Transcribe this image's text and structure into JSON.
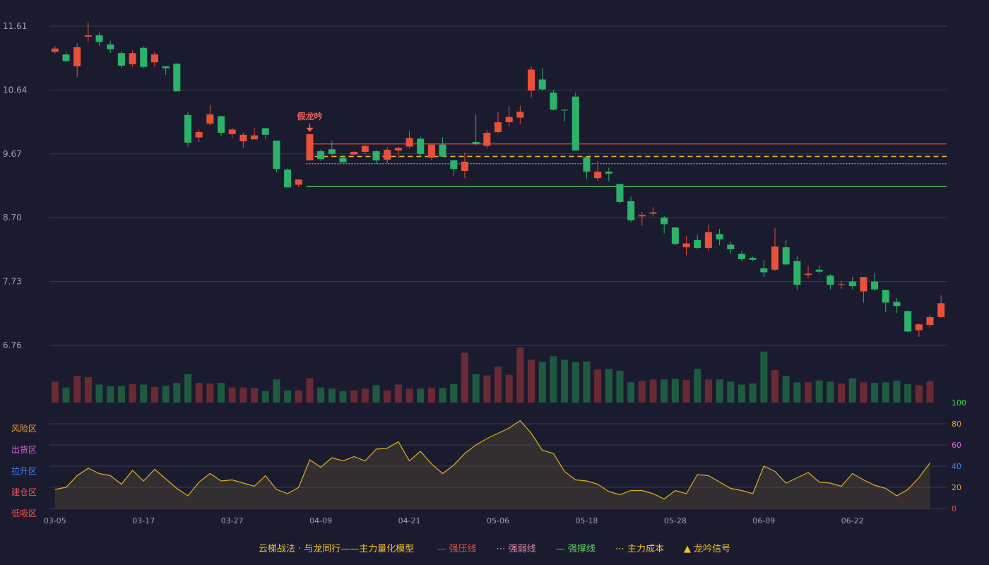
{
  "colors": {
    "background": "#1a1b2e",
    "grid": "#3a3b4e",
    "up": "#e8503a",
    "down": "#2bb36a",
    "resistance": "#e8503a",
    "weak": "#e887a8",
    "support": "#5ad25a",
    "cost": "#f0c030",
    "indicator_line": "#e0b020",
    "axis_text": "#a0a0b0"
  },
  "chart_data": {
    "type": "candlestick",
    "price_axis": {
      "ticks": [
        "11.61",
        "10.64",
        "9.67",
        "8.70",
        "7.73",
        "6.76"
      ],
      "range": [
        6.76,
        11.61
      ]
    },
    "x_tick_labels": [
      {
        "index": 0,
        "label": "03-05"
      },
      {
        "index": 8,
        "label": "03-17"
      },
      {
        "index": 16,
        "label": "03-27"
      },
      {
        "index": 24,
        "label": "04-09"
      },
      {
        "index": 32,
        "label": "04-21"
      },
      {
        "index": 40,
        "label": "05-06"
      },
      {
        "index": 48,
        "label": "05-18"
      },
      {
        "index": 56,
        "label": "05-28"
      },
      {
        "index": 64,
        "label": "06-09"
      },
      {
        "index": 72,
        "label": "06-22"
      }
    ],
    "candles": [
      [
        11.22,
        11.27,
        11.31,
        11.19
      ],
      [
        11.18,
        11.08,
        11.23,
        11.06
      ],
      [
        11.0,
        11.29,
        11.35,
        10.84
      ],
      [
        11.45,
        11.47,
        11.67,
        11.37
      ],
      [
        11.47,
        11.37,
        11.51,
        11.31
      ],
      [
        11.33,
        11.26,
        11.39,
        11.2
      ],
      [
        11.2,
        11.01,
        11.23,
        10.97
      ],
      [
        11.03,
        11.2,
        11.24,
        10.99
      ],
      [
        11.28,
        10.99,
        11.3,
        10.97
      ],
      [
        11.06,
        11.18,
        11.22,
        10.99
      ],
      [
        11.0,
        10.97,
        11.0,
        10.87
      ],
      [
        11.04,
        10.62,
        11.04,
        10.62
      ],
      [
        10.26,
        9.84,
        10.3,
        9.78
      ],
      [
        9.92,
        10.0,
        10.04,
        9.85
      ],
      [
        10.13,
        10.27,
        10.41,
        10.1
      ],
      [
        10.24,
        9.99,
        10.25,
        9.94
      ],
      [
        9.97,
        10.04,
        10.06,
        9.91
      ],
      [
        9.86,
        9.96,
        9.99,
        9.76
      ],
      [
        9.89,
        9.95,
        10.06,
        9.89
      ],
      [
        10.06,
        9.96,
        10.06,
        9.9
      ],
      [
        9.87,
        9.44,
        9.87,
        9.39
      ],
      [
        9.43,
        9.16,
        9.45,
        9.16
      ],
      [
        9.2,
        9.28,
        9.28,
        9.16
      ],
      [
        9.57,
        9.97,
        9.97,
        9.57
      ],
      [
        9.71,
        9.59,
        9.74,
        9.56
      ],
      [
        9.74,
        9.67,
        9.87,
        9.64
      ],
      [
        9.61,
        9.54,
        9.65,
        9.54
      ],
      [
        9.66,
        9.7,
        9.71,
        9.65
      ],
      [
        9.7,
        9.79,
        9.81,
        9.66
      ],
      [
        9.71,
        9.57,
        9.73,
        9.52
      ],
      [
        9.58,
        9.73,
        9.77,
        9.53
      ],
      [
        9.72,
        9.76,
        9.78,
        9.61
      ],
      [
        9.78,
        9.91,
        10.02,
        9.75
      ],
      [
        9.9,
        9.67,
        9.93,
        9.63
      ],
      [
        9.61,
        9.81,
        9.81,
        9.57
      ],
      [
        9.81,
        9.63,
        9.92,
        9.63
      ],
      [
        9.57,
        9.44,
        9.58,
        9.34
      ],
      [
        9.41,
        9.55,
        9.69,
        9.3
      ],
      [
        9.85,
        9.82,
        10.27,
        9.8
      ],
      [
        9.79,
        9.99,
        10.03,
        9.75
      ],
      [
        10.0,
        10.15,
        10.3,
        9.98
      ],
      [
        10.15,
        10.23,
        10.39,
        10.08
      ],
      [
        10.22,
        10.31,
        10.4,
        10.13
      ],
      [
        10.63,
        10.95,
        11.0,
        10.52
      ],
      [
        10.8,
        10.65,
        10.97,
        10.62
      ],
      [
        10.6,
        10.34,
        10.64,
        10.33
      ],
      [
        10.34,
        10.33,
        10.34,
        10.16
      ],
      [
        10.54,
        9.72,
        10.6,
        9.72
      ],
      [
        9.62,
        9.4,
        9.62,
        9.29
      ],
      [
        9.3,
        9.4,
        9.56,
        9.26
      ],
      [
        9.4,
        9.37,
        9.46,
        9.25
      ],
      [
        9.21,
        8.94,
        9.21,
        8.91
      ],
      [
        8.95,
        8.66,
        9.02,
        8.63
      ],
      [
        8.72,
        8.74,
        8.79,
        8.58
      ],
      [
        8.76,
        8.78,
        8.86,
        8.72
      ],
      [
        8.7,
        8.6,
        8.73,
        8.46
      ],
      [
        8.55,
        8.3,
        8.56,
        8.28
      ],
      [
        8.25,
        8.31,
        8.42,
        8.13
      ],
      [
        8.36,
        8.24,
        8.44,
        8.22
      ],
      [
        8.24,
        8.48,
        8.59,
        8.2
      ],
      [
        8.45,
        8.37,
        8.53,
        8.28
      ],
      [
        8.29,
        8.22,
        8.34,
        8.15
      ],
      [
        8.15,
        8.07,
        8.2,
        8.04
      ],
      [
        8.09,
        8.06,
        8.11,
        8.04
      ],
      [
        7.93,
        7.87,
        8.06,
        7.8
      ],
      [
        7.91,
        8.26,
        8.54,
        7.89
      ],
      [
        8.25,
        7.99,
        8.36,
        7.97
      ],
      [
        8.04,
        7.68,
        8.12,
        7.6
      ],
      [
        7.83,
        7.85,
        7.97,
        7.78
      ],
      [
        7.91,
        7.88,
        7.98,
        7.85
      ],
      [
        7.82,
        7.68,
        7.84,
        7.61
      ],
      [
        7.68,
        7.69,
        7.74,
        7.62
      ],
      [
        7.73,
        7.66,
        7.8,
        7.61
      ],
      [
        7.58,
        7.8,
        7.8,
        7.41
      ],
      [
        7.73,
        7.61,
        7.86,
        7.59
      ],
      [
        7.6,
        7.41,
        7.6,
        7.26
      ],
      [
        7.42,
        7.36,
        7.48,
        7.25
      ],
      [
        7.28,
        6.97,
        7.29,
        6.96
      ],
      [
        6.99,
        7.08,
        7.09,
        6.89
      ],
      [
        7.07,
        7.19,
        7.23,
        7.03
      ],
      [
        7.19,
        7.4,
        7.52,
        7.18
      ]
    ],
    "volume": [
      0.36,
      0.26,
      0.46,
      0.44,
      0.31,
      0.28,
      0.29,
      0.32,
      0.31,
      0.27,
      0.29,
      0.34,
      0.49,
      0.34,
      0.33,
      0.34,
      0.26,
      0.26,
      0.25,
      0.2,
      0.4,
      0.21,
      0.21,
      0.42,
      0.26,
      0.24,
      0.2,
      0.21,
      0.24,
      0.3,
      0.21,
      0.31,
      0.24,
      0.24,
      0.25,
      0.25,
      0.32,
      0.86,
      0.49,
      0.47,
      0.62,
      0.48,
      0.95,
      0.74,
      0.7,
      0.8,
      0.74,
      0.7,
      0.71,
      0.57,
      0.58,
      0.55,
      0.35,
      0.37,
      0.4,
      0.4,
      0.41,
      0.39,
      0.58,
      0.4,
      0.4,
      0.36,
      0.31,
      0.33,
      0.88,
      0.56,
      0.46,
      0.35,
      0.35,
      0.38,
      0.36,
      0.33,
      0.42,
      0.35,
      0.34,
      0.35,
      0.38,
      0.32,
      0.3,
      0.37
    ],
    "levels": {
      "resistance": 9.82,
      "weak": 9.52,
      "cost": 9.63,
      "support": 9.17,
      "start_index": 23
    },
    "signal": {
      "index": 23,
      "label": "假龙吟"
    },
    "indicator": {
      "axis_ticks": [
        "100",
        "80",
        "60",
        "40",
        "20",
        "0"
      ],
      "zones": [
        "风险区",
        "出货区",
        "拉升区",
        "建仓区",
        "低吸区"
      ],
      "zone_colors": [
        "#f0a030",
        "#e060e0",
        "#4080ff",
        "#f05050",
        "#f05050"
      ],
      "tick_colors": [
        "#40e040",
        "#f0a030",
        "#e060e0",
        "#4080ff",
        "#f0a030",
        "#f05050"
      ],
      "values": [
        18,
        20,
        31,
        38,
        33,
        31,
        23,
        36,
        26,
        37,
        28,
        19,
        12,
        25,
        33,
        26,
        27,
        24,
        21,
        31,
        18,
        14,
        20,
        46,
        39,
        48,
        45,
        49,
        45,
        56,
        57,
        63,
        45,
        54,
        42,
        33,
        41,
        52,
        60,
        66,
        71,
        76,
        83,
        71,
        55,
        52,
        35,
        27,
        26,
        23,
        16,
        13,
        17,
        17,
        14,
        9,
        17,
        14,
        32,
        31,
        25,
        19,
        17,
        14,
        40,
        35,
        24,
        29,
        34,
        25,
        24,
        21,
        33,
        27,
        22,
        19,
        12,
        18,
        29,
        43
      ]
    },
    "legend": {
      "title": "云梯战法 · 与龙同行——主力量化模型",
      "items": [
        {
          "symbol": "—",
          "label": "强压线",
          "color": "#e8503a"
        },
        {
          "symbol": "⋯",
          "label": "强弱线",
          "color": "#e887a8"
        },
        {
          "symbol": "—",
          "label": "强撑线",
          "color": "#5ad25a"
        },
        {
          "symbol": "⋯",
          "label": "主力成本",
          "color": "#f0c030"
        },
        {
          "symbol": "▲",
          "label": "龙吟信号",
          "color": "#f0c030"
        }
      ]
    }
  }
}
